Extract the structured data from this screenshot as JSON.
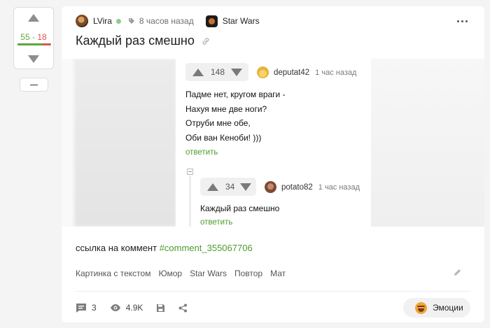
{
  "rating": {
    "plus": "55",
    "separator": "-",
    "minus": "18",
    "positive_share": 0.753
  },
  "post": {
    "author": "LVira",
    "time": "8 часов назад",
    "community": "Star Wars",
    "title": "Каждый раз смешно",
    "comment_ref_text": "ссылка на коммент ",
    "comment_ref_anchor": "#comment_355067706",
    "tags": [
      "Картинка с текстом",
      "Юмор",
      "Star Wars",
      "Повтор",
      "Мат"
    ],
    "footer": {
      "comments": "3",
      "views": "4.9K",
      "emotions_label": "Эмоции"
    }
  },
  "image_comments": {
    "first": {
      "rating": "148",
      "user": "deputat42",
      "time": "1 час назад",
      "lines": [
        "Падме нет, кругом враги -",
        "Нахуя мне две ноги?",
        "Отруби мне обе,",
        "Оби ван Кеноби! )))"
      ],
      "reply": "ответить"
    },
    "second": {
      "rating": "34",
      "user": "potato82",
      "time": "1 час назад",
      "text": "Каждый раз смешно",
      "reply": "ответить"
    }
  },
  "colors": {
    "accent": "#4f9b2e",
    "positive": "#5fa53b",
    "negative": "#e4504c"
  }
}
